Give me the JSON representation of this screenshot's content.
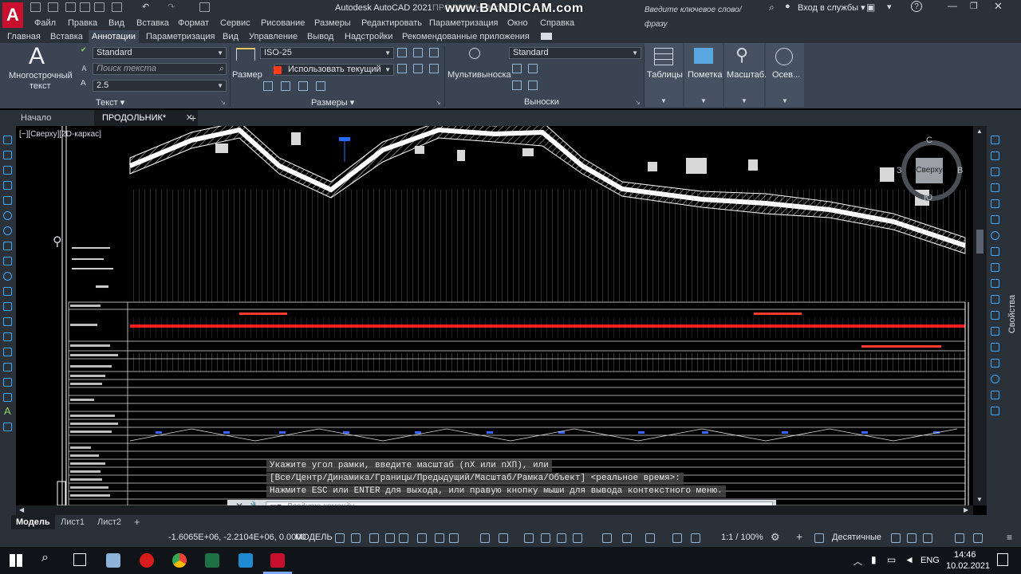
{
  "titlebar": {
    "title": "Autodesk AutoCAD 2021",
    "file_title": "ПРОДОЛЬНИК.dwg",
    "watermark": "www.BANDICAM.com",
    "search_placeholder": "Введите ключевое слово/фразу",
    "signin": "Вход в службы",
    "app_letter": "A"
  },
  "menubar": {
    "items": [
      "Файл",
      "Правка",
      "Вид",
      "Вставка",
      "Формат",
      "Сервис",
      "Рисование",
      "Размеры",
      "Редактировать",
      "Параметризация",
      "Окно",
      "Справка"
    ]
  },
  "ribbon_tabs": {
    "items": [
      "Главная",
      "Вставка",
      "Аннотации",
      "Параметризация",
      "Вид",
      "Управление",
      "Вывод",
      "Надстройки",
      "Рекомендованные приложения"
    ],
    "active": "Аннотации"
  },
  "ribbon": {
    "text_panel": {
      "mtext_label_1": "Многострочный",
      "mtext_label_2": "текст",
      "style_value": "Standard",
      "search_placeholder": "Поиск текста",
      "height_value": "2.5",
      "title": "Текст"
    },
    "dim_panel": {
      "dim_button": "Размер",
      "style_value": "ISO-25",
      "layer_value": "Использовать текущий",
      "title": "Размеры"
    },
    "leader_panel": {
      "mleader_label": "Мультивыноска",
      "style_value": "Standard",
      "title": "Выноски"
    },
    "tables_label": "Таблицы",
    "markup_label": "Пометка",
    "scale_label": "Масштаб...",
    "axis_label": "Осев..."
  },
  "file_tabs": {
    "start": "Начало",
    "active": "ПРОДОЛЬНИК*",
    "add": "+"
  },
  "viewport": {
    "label": "[−][Сверху][2D-каркас]"
  },
  "viewcube": {
    "top": "Сверху",
    "north": "С",
    "west": "З",
    "east": "В",
    "south": "Ю"
  },
  "command": {
    "line1": "Укажите угол рамки, введите масштаб (nX или nXП), или",
    "line2": "[Все/Центр/Динамика/Границы/Предыдущий/Масштаб/Рамка/Объект] <реальное время>:",
    "line3": "Нажмите ESC или ENTER для выхода, или правую кнопку мыши для вывода контекстного меню.",
    "input_placeholder": "Введите команду"
  },
  "layout_tabs": {
    "items": [
      "Модель",
      "Лист1",
      "Лист2"
    ],
    "active": "Модель",
    "add": "+"
  },
  "statusbar": {
    "coords": "-1.6065E+06, -2.2104E+06, 0.0000",
    "model": "МОДЕЛЬ",
    "scale": "1:1 / 100%",
    "units": "Десятичные"
  },
  "properties_panel": {
    "label": "Свойства"
  },
  "taskbar": {
    "language": "ENG",
    "time": "14:46",
    "date": "10.02.2021"
  },
  "colors": {
    "accent_red": "#e8262b",
    "ribbon_bg": "#3b4452",
    "profile_red_line": "#ff1a1a"
  }
}
